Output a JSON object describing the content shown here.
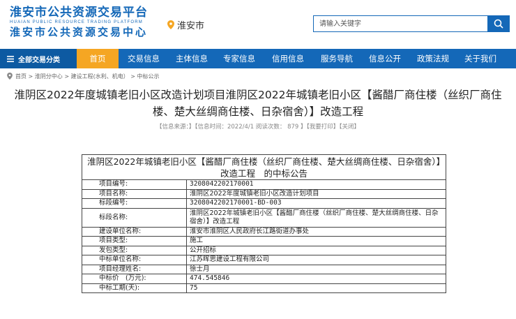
{
  "header": {
    "logo_cn": "淮安市公共资源交易平台",
    "logo_en": "HUAIAN PUBLIC RESOURCE TRADING PLATFORM",
    "logo_cn2": "淮安市公共资源交易中心",
    "location": "淮安市",
    "search_placeholder": "请输入关键字"
  },
  "nav": {
    "all_categories": "全部交易分类",
    "items": [
      {
        "label": "首页",
        "active": true,
        "w": 60
      },
      {
        "label": "交易信息",
        "w": 72
      },
      {
        "label": "主体信息",
        "w": 66
      },
      {
        "label": "专家信息",
        "w": 70
      },
      {
        "label": "信用信息",
        "w": 70
      },
      {
        "label": "服务导航",
        "w": 70
      },
      {
        "label": "信息公开",
        "w": 68
      },
      {
        "label": "政策法规",
        "w": 70
      },
      {
        "label": "关于我们",
        "w": 66
      }
    ]
  },
  "breadcrumb": "首页 > 淮阴分中心 > 建设工程(水利、机电） > 中标公示",
  "article": {
    "title": "淮阴区2022年度城镇老旧小区改造计划项目淮阴区2022年城镇老旧小区【酱醋厂商住楼（丝织厂商住楼、楚大丝绸商住楼、日杂宿舍）】改造工程",
    "meta": "【信息来源：】【信息时间：2022/4/1 阅读次数： 879 】【我要打印】【关闭】"
  },
  "table": {
    "heading": "淮阴区2022年城镇老旧小区【酱醋厂商住楼（丝织厂商住楼、楚大丝绸商住楼、日杂宿舍）】改造工程　的中标公告",
    "rows": [
      {
        "k": "项目编号:",
        "v": "3208042202170001",
        "mono": true
      },
      {
        "k": "项目名称:",
        "v": "淮阴区2022年度城镇老旧小区改造计划项目"
      },
      {
        "k": "标段编号:",
        "v": "3208042202170001-BD-003",
        "mono": true
      },
      {
        "k": "标段名称:",
        "v": "淮阴区2022年城镇老旧小区【酱醋厂商住楼（丝织厂商住楼、楚大丝绸商住楼、日杂宿舍）】改造工程",
        "tall": true
      },
      {
        "k": "建设单位名称:",
        "v": "淮安市淮阴区人民政府长江路街道办事处"
      },
      {
        "k": "项目类型:",
        "v": "施工"
      },
      {
        "k": "发包类型:",
        "v": "公开招标"
      },
      {
        "k": "中标单位名称:",
        "v": "江苏晖思建设工程有限公司"
      },
      {
        "k": "项目经理姓名:",
        "v": "徐士月"
      },
      {
        "k": "中标价　(万元):",
        "v": "474.545846",
        "mono": true
      },
      {
        "k": "中标工期(天):",
        "v": "75",
        "mono": true
      }
    ]
  },
  "colors": {
    "primary": "#1468b8",
    "active": "#f5a623"
  }
}
